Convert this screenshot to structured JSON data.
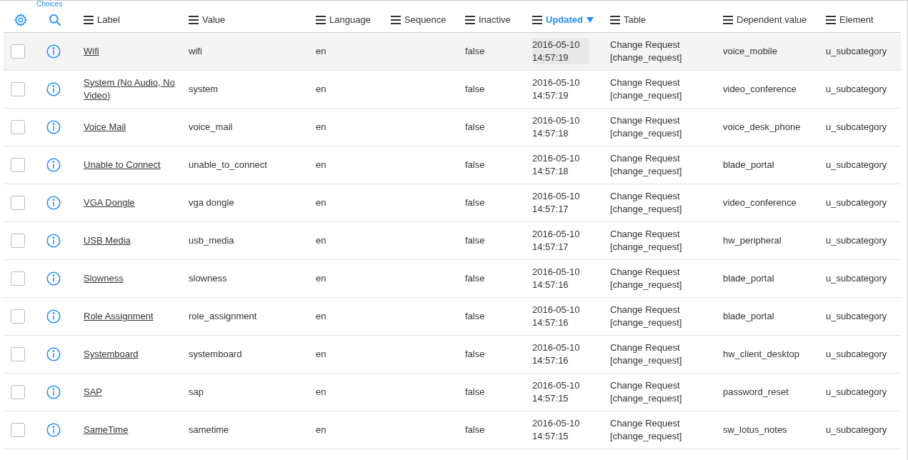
{
  "breadcrumb": {
    "label": "Choices"
  },
  "columns": [
    {
      "label": "Label",
      "sorted": false
    },
    {
      "label": "Value",
      "sorted": false
    },
    {
      "label": "Language",
      "sorted": false
    },
    {
      "label": "Sequence",
      "sorted": false
    },
    {
      "label": "Inactive",
      "sorted": false
    },
    {
      "label": "Updated",
      "sorted": true
    },
    {
      "label": "Table",
      "sorted": false
    },
    {
      "label": "Dependent value",
      "sorted": false
    },
    {
      "label": "Element",
      "sorted": false
    }
  ],
  "rows": [
    {
      "highlighted": true,
      "checked": false,
      "label": "Wifi",
      "value": "wifi",
      "language": "en",
      "inactive": "false",
      "updated": [
        "2016-05-10",
        "14:57:19"
      ],
      "table": [
        "Change Request",
        "[change_request]"
      ],
      "dependent_value": "voice_mobile",
      "element": "u_subcategory"
    },
    {
      "highlighted": false,
      "checked": false,
      "label": "System (No Audio, No Video)",
      "value": "system",
      "language": "en",
      "inactive": "false",
      "updated": [
        "2016-05-10",
        "14:57:19"
      ],
      "table": [
        "Change Request",
        "[change_request]"
      ],
      "dependent_value": "video_conference",
      "element": "u_subcategory"
    },
    {
      "highlighted": false,
      "checked": false,
      "label": "Voice Mail",
      "value": "voice_mail",
      "language": "en",
      "inactive": "false",
      "updated": [
        "2016-05-10",
        "14:57:18"
      ],
      "table": [
        "Change Request",
        "[change_request]"
      ],
      "dependent_value": "voice_desk_phone",
      "element": "u_subcategory"
    },
    {
      "highlighted": false,
      "checked": false,
      "label": "Unable to Connect",
      "value": "unable_to_connect",
      "language": "en",
      "inactive": "false",
      "updated": [
        "2016-05-10",
        "14:57:18"
      ],
      "table": [
        "Change Request",
        "[change_request]"
      ],
      "dependent_value": "blade_portal",
      "element": "u_subcategory"
    },
    {
      "highlighted": false,
      "checked": false,
      "label": "VGA Dongle",
      "value": "vga dongle",
      "language": "en",
      "inactive": "false",
      "updated": [
        "2016-05-10",
        "14:57:17"
      ],
      "table": [
        "Change Request",
        "[change_request]"
      ],
      "dependent_value": "video_conference",
      "element": "u_subcategory"
    },
    {
      "highlighted": false,
      "checked": false,
      "label": "USB Media",
      "value": "usb_media",
      "language": "en",
      "inactive": "false",
      "updated": [
        "2016-05-10",
        "14:57:17"
      ],
      "table": [
        "Change Request",
        "[change_request]"
      ],
      "dependent_value": "hw_peripheral",
      "element": "u_subcategory"
    },
    {
      "highlighted": false,
      "checked": false,
      "label": "Slowness",
      "value": "slowness",
      "language": "en",
      "inactive": "false",
      "updated": [
        "2016-05-10",
        "14:57:16"
      ],
      "table": [
        "Change Request",
        "[change_request]"
      ],
      "dependent_value": "blade_portal",
      "element": "u_subcategory"
    },
    {
      "highlighted": false,
      "checked": false,
      "label": "Role Assignment",
      "value": "role_assignment",
      "language": "en",
      "inactive": "false",
      "updated": [
        "2016-05-10",
        "14:57:16"
      ],
      "table": [
        "Change Request",
        "[change_request]"
      ],
      "dependent_value": "blade_portal",
      "element": "u_subcategory"
    },
    {
      "highlighted": false,
      "checked": false,
      "label": "Systemboard",
      "value": "systemboard",
      "language": "en",
      "inactive": "false",
      "updated": [
        "2016-05-10",
        "14:57:16"
      ],
      "table": [
        "Change Request",
        "[change_request]"
      ],
      "dependent_value": "hw_client_desktop",
      "element": "u_subcategory"
    },
    {
      "highlighted": false,
      "checked": false,
      "label": "SAP",
      "value": "sap",
      "language": "en",
      "inactive": "false",
      "updated": [
        "2016-05-10",
        "14:57:15"
      ],
      "table": [
        "Change Request",
        "[change_request]"
      ],
      "dependent_value": "password_reset",
      "element": "u_subcategory"
    },
    {
      "highlighted": false,
      "checked": false,
      "label": "SameTime",
      "value": "sametime",
      "language": "en",
      "inactive": "false",
      "updated": [
        "2016-05-10",
        "14:57:15"
      ],
      "table": [
        "Change Request",
        "[change_request]"
      ],
      "dependent_value": "sw_lotus_notes",
      "element": "u_subcategory"
    }
  ]
}
